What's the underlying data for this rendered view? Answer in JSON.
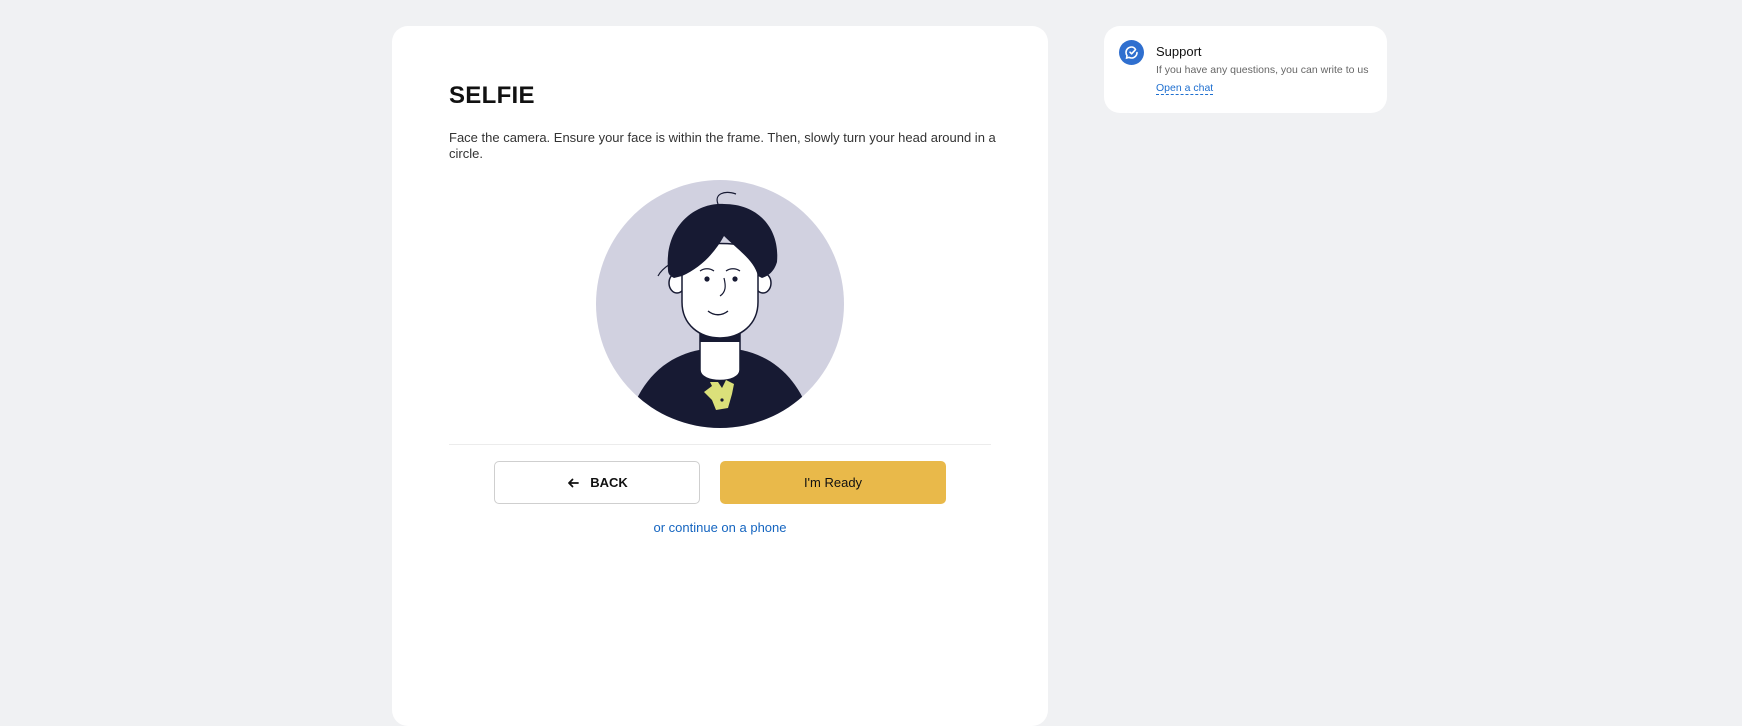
{
  "step": {
    "title": "SELFIE",
    "instructions": "Face the camera. Ensure your face is within the frame. Then, slowly turn your head around in a circle."
  },
  "actions": {
    "back_label": "BACK",
    "ready_label": "I'm Ready",
    "phone_link": "or continue on a phone"
  },
  "support": {
    "title": "Support",
    "text": "If you have any questions, you can write to us",
    "link": "Open a chat"
  },
  "icons": {
    "back": "arrow-left-icon",
    "support": "chat-bubble-icon",
    "illustration": "selfie-person-illustration"
  },
  "colors": {
    "page_background": "#f0f1f3",
    "primary_button": "#e9b94a",
    "link": "#1565c0",
    "illustration_bg": "#d1d1e0",
    "illustration_dark": "#171a33",
    "logo": "#dbe07a",
    "support_icon": "#2f6fcf"
  }
}
